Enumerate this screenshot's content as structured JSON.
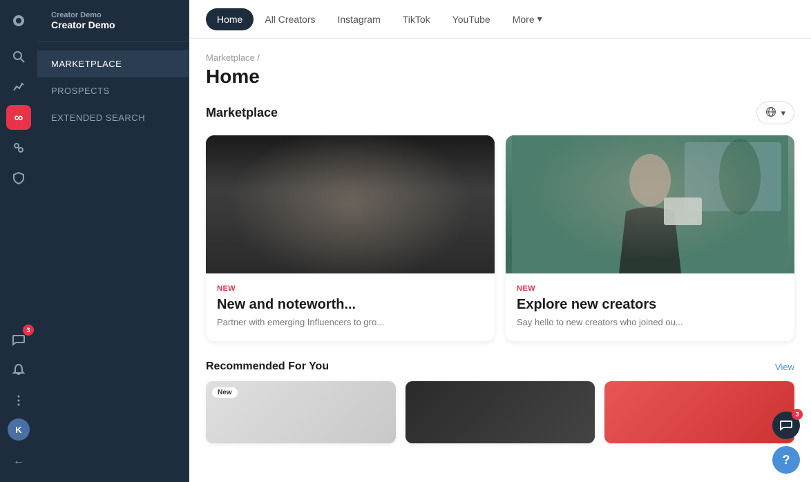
{
  "brand": {
    "label": "Creator Demo",
    "subtitle": "Creator Demo"
  },
  "sidebar": {
    "items": [
      {
        "id": "marketplace",
        "label": "MARKETPLACE",
        "active": true
      },
      {
        "id": "prospects",
        "label": "PROSPECTS",
        "active": false
      },
      {
        "id": "extended-search",
        "label": "EXTENDED SEARCH",
        "active": false
      }
    ]
  },
  "nav": {
    "tabs": [
      {
        "id": "home",
        "label": "Home",
        "active": true
      },
      {
        "id": "all-creators",
        "label": "All Creators",
        "active": false
      },
      {
        "id": "instagram",
        "label": "Instagram",
        "active": false
      },
      {
        "id": "tiktok",
        "label": "TikTok",
        "active": false
      },
      {
        "id": "youtube",
        "label": "YouTube",
        "active": false
      },
      {
        "id": "more",
        "label": "More",
        "active": false
      }
    ]
  },
  "breadcrumb": "Marketplace /",
  "page_title": "Home",
  "marketplace": {
    "title": "Marketplace",
    "globe_label": ""
  },
  "cards": [
    {
      "tag": "NEW",
      "title": "New and noteworth...",
      "description": "Partner with emerging Influencers to gro..."
    },
    {
      "tag": "NEW",
      "title": "Explore new creators",
      "description": "Say hello to new creators who joined ou..."
    }
  ],
  "recommended": {
    "title": "Recommended For You",
    "view_label": "View",
    "cards": [
      {
        "badge": "New"
      },
      {
        "badge": ""
      },
      {
        "badge": ""
      }
    ]
  },
  "floats": {
    "chat_badge": "3",
    "widget_badge": "3",
    "help_label": "?"
  },
  "icons": {
    "search": "🔍",
    "triangle": "△",
    "infinity": "∞",
    "cross": "✕",
    "shield": "🛡",
    "dots": "⋯",
    "bell": "🔔",
    "chat": "💬",
    "chevron_down": "▾"
  }
}
